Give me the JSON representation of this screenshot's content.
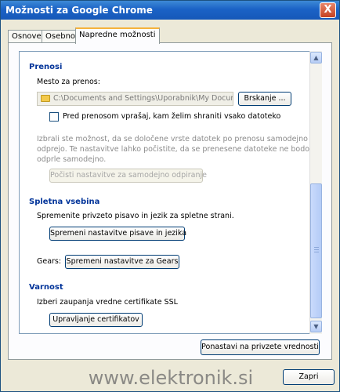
{
  "window": {
    "title": "Možnosti za Google Chrome",
    "close_glyph": "X"
  },
  "tabs": [
    {
      "label": "Osnove"
    },
    {
      "label": "Osebno"
    },
    {
      "label": "Napredne možnosti"
    }
  ],
  "downloads": {
    "title": "Prenosi",
    "location_label": "Mesto za prenos:",
    "path": "C:\\Documents and Settings\\Uporabnik\\My Documents",
    "browse_button": "Brskanje ...",
    "ask_checkbox_label": "Pred prenosom vprašaj, kam želim shraniti vsako datoteko",
    "ask_checked": false,
    "auto_open_text_1": "Izbrali ste možnost, da se določene vrste datotek po prenosu samodejno",
    "auto_open_text_2": "odprejo. Te nastavitve lahko počistite, da se prenesene datoteke ne bodo",
    "auto_open_text_3": "odprle samodejno.",
    "clear_button": "Počisti nastavitve za samodejno odpiranje"
  },
  "web_content": {
    "title": "Spletna vsebina",
    "description": "Spremenite privzeto pisavo in jezik za spletne strani.",
    "fonts_button": "Spremeni nastavitve pisave in jezika",
    "gears_label": "Gears:",
    "gears_button": "Spremeni nastavitve za Gears"
  },
  "security": {
    "title": "Varnost",
    "description": "Izberi zaupanja vredne certifikate SSL",
    "certificates_button": "Upravljanje certifikatov"
  },
  "footer": {
    "reset_button": "Ponastavi na privzete vrednosti",
    "close_button": "Zapri"
  },
  "watermark": "www.elektronik.si"
}
